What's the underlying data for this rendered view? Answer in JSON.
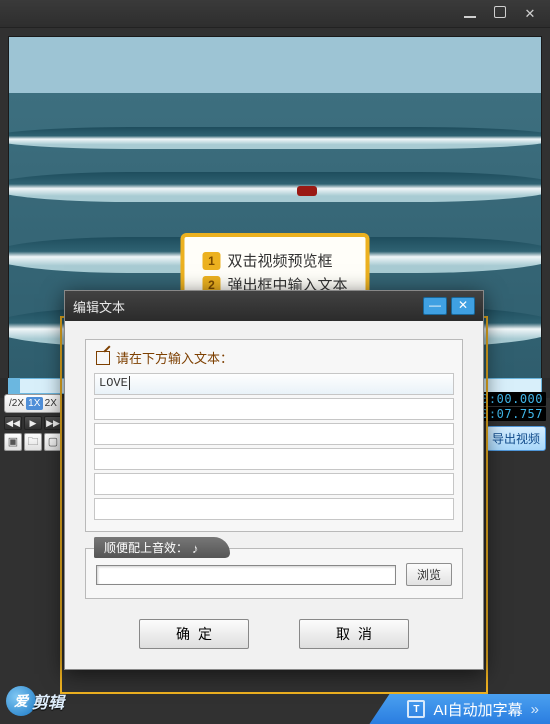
{
  "window_controls": {
    "minimize": "—",
    "maximize": "▢",
    "close": "✕"
  },
  "tooltip": {
    "items": [
      {
        "num": "1",
        "text": "双击视频预览框"
      },
      {
        "num": "2",
        "text": "弹出框中输入文本"
      }
    ]
  },
  "speed": {
    "options": [
      "/2X",
      "1X",
      "2X"
    ],
    "active": "1X"
  },
  "arrows": {
    "prev": "◀◀",
    "play": "▶",
    "next": "▶▶"
  },
  "folders": {
    "a": "▣",
    "b": "🗀",
    "c": "▢"
  },
  "timecode": {
    "current": "0:00.000",
    "total": "0:07.757",
    "export_label": "导出视频"
  },
  "dialog": {
    "title": "编辑文本",
    "minimize": "—",
    "close": "✕",
    "prompt": "请在下方输入文本：",
    "input_value": "LOVE",
    "sound_label": "顺便配上音效：",
    "browse": "浏览",
    "ok": "确定",
    "cancel": "取消"
  },
  "brand": {
    "logo_letter": "爱",
    "text": "剪辑"
  },
  "ai_subtitle": {
    "icon_text": "T",
    "label": "AI自动加字幕",
    "chev": "»"
  }
}
